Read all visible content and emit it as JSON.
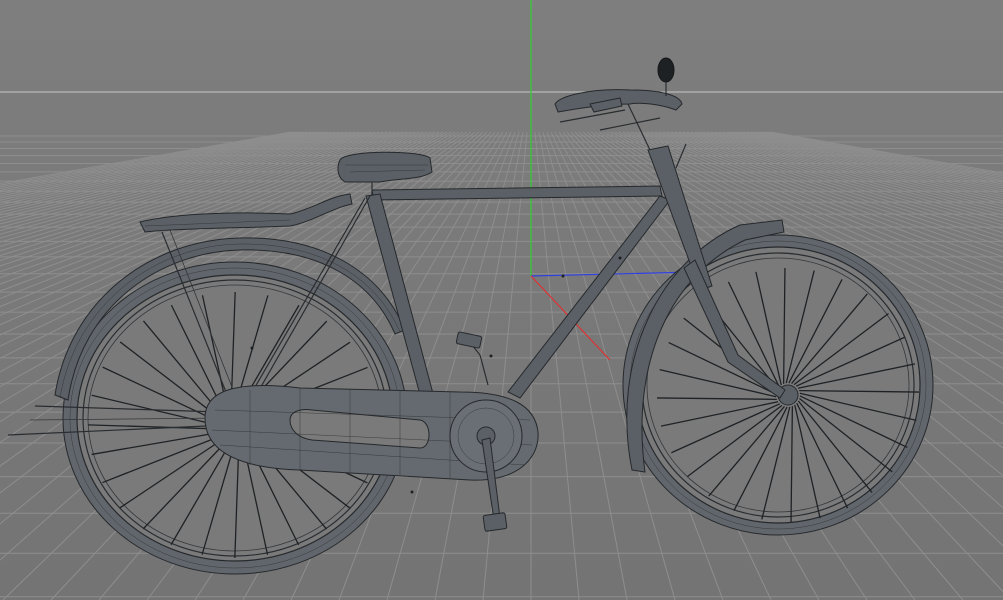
{
  "viewport": {
    "background_color": "#7a7a7a",
    "grid_color": "#8e8e8e",
    "horizon_color": "#c8c8c8",
    "axis_colors": {
      "x": "#e03030",
      "y": "#30d030",
      "z": "#3040e0"
    }
  },
  "model": {
    "object": "bicycle",
    "display_mode": "wireframe-shaded",
    "wire_color": "#2a2d30",
    "surface_color": "#5b6066"
  }
}
